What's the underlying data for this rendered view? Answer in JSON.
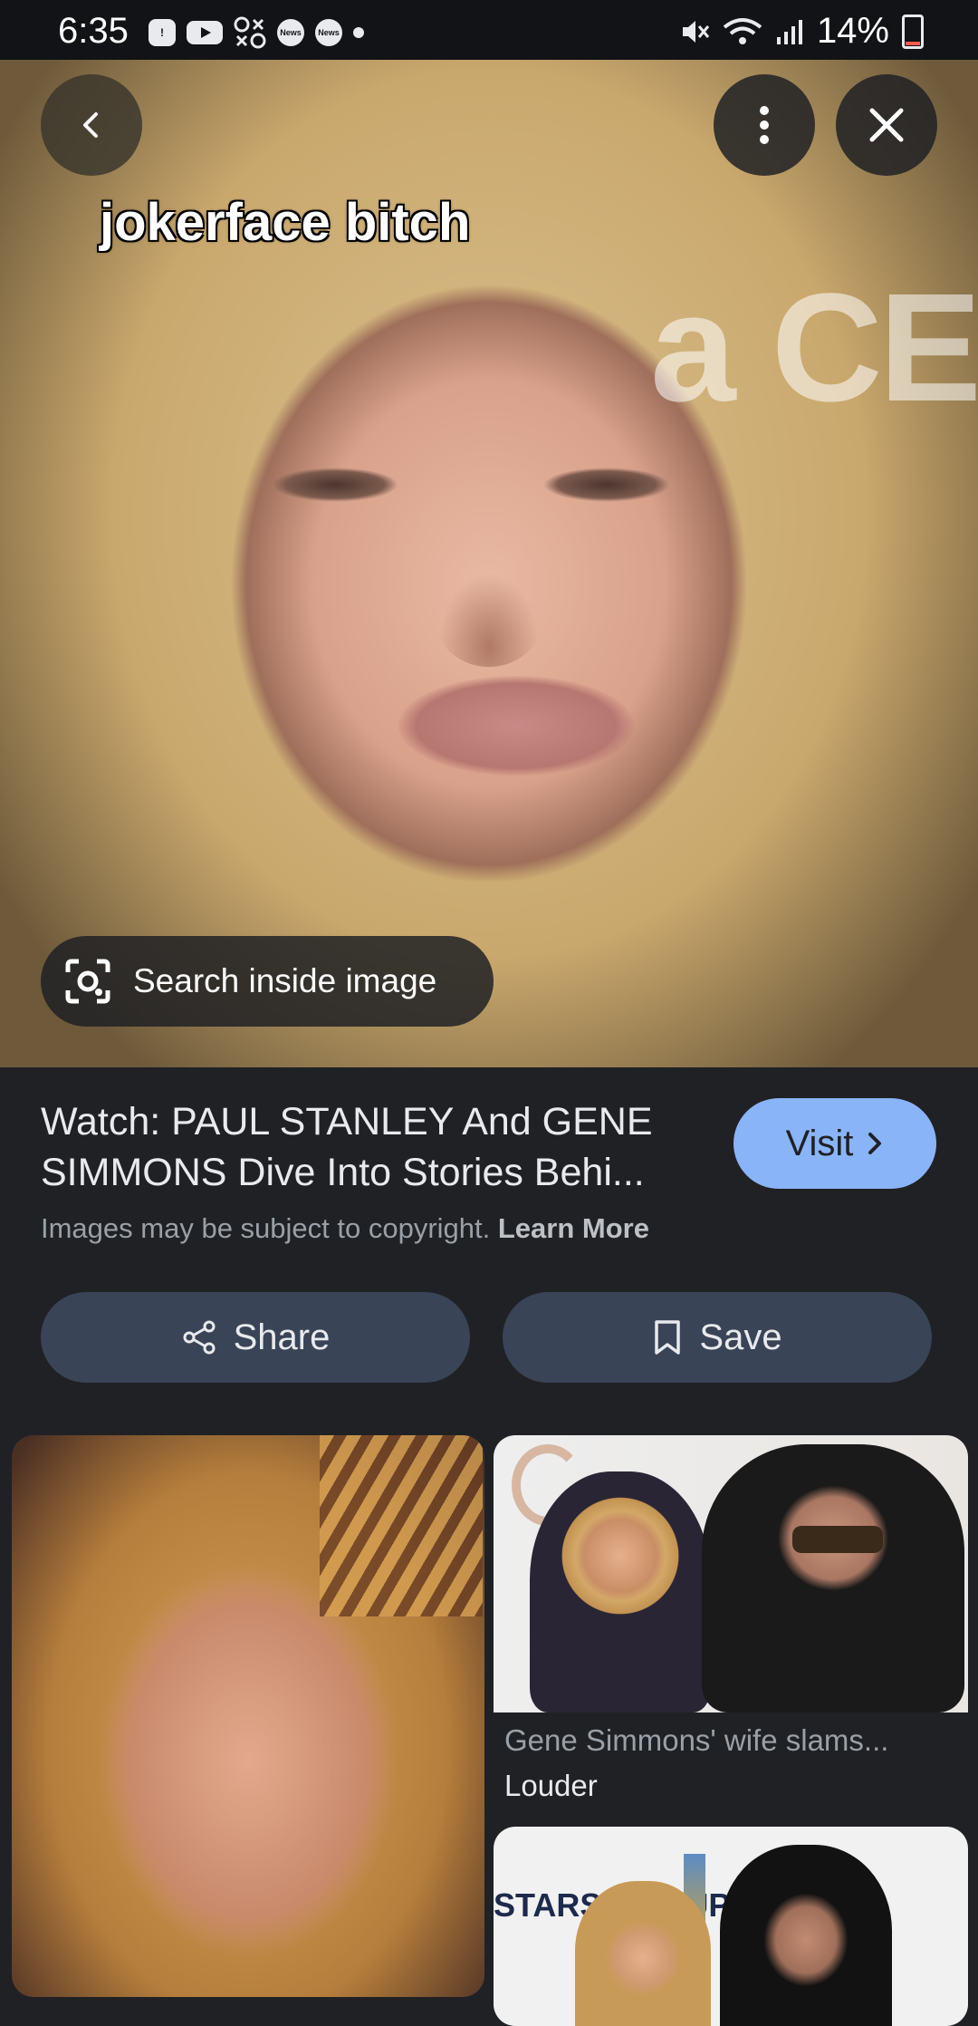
{
  "status_bar": {
    "time": "6:35",
    "battery": "14%",
    "left_icons": [
      "alert-icon",
      "youtube-icon",
      "app-icon",
      "news-icon",
      "news-icon",
      "dot"
    ],
    "news_label": "News"
  },
  "viewer": {
    "caption": "jokerface bitch",
    "background_text": "a  CE",
    "search_inside_label": "Search inside image"
  },
  "result": {
    "title": "Watch: PAUL STANLEY And GENE SIMMONS Dive Into Stories Behi...",
    "visit_label": "Visit",
    "copyright_text": "Images may be subject to copyright.",
    "learn_more_label": "Learn More",
    "share_label": "Share",
    "save_label": "Save"
  },
  "related": {
    "items": [
      {
        "caption": "",
        "source": ""
      },
      {
        "caption": "Gene Simmons' wife slams...",
        "source": "Louder"
      },
      {
        "caption": "",
        "source": "",
        "image_text": "STARS GROUP"
      }
    ]
  },
  "colors": {
    "background": "#202124",
    "visit_button": "#8ab4f8",
    "action_button": "#394457",
    "battery_low": "#ff5b4f"
  }
}
